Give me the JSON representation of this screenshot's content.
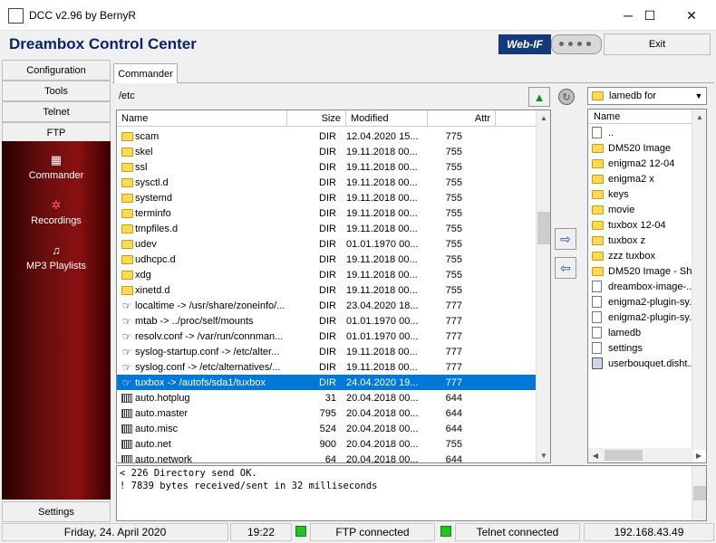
{
  "window": {
    "title": "DCC v2.96 by BernyR",
    "minimize": "─",
    "maximize": "☐",
    "close": "✕"
  },
  "header": {
    "app_title": "Dreambox Control Center",
    "webif_label": "Web-IF",
    "exit_label": "Exit"
  },
  "sidebar": {
    "buttons": [
      "Configuration",
      "Tools",
      "Telnet",
      "FTP"
    ],
    "panel_items": [
      {
        "label": "Commander",
        "icon": "grid-icon"
      },
      {
        "label": "Recordings",
        "icon": "film-icon"
      },
      {
        "label": "MP3 Playlists",
        "icon": "note-icon"
      }
    ],
    "settings_label": "Settings"
  },
  "commander": {
    "tab_label": "Commander",
    "path": "/etc",
    "columns": {
      "name": "Name",
      "size": "Size",
      "modified": "Modified",
      "attr": "Attr"
    },
    "rows": [
      {
        "icon": "folder",
        "name": "scam",
        "size": "DIR",
        "modified": "12.04.2020 15...",
        "attr": "775"
      },
      {
        "icon": "folder",
        "name": "skel",
        "size": "DIR",
        "modified": "19.11.2018 00...",
        "attr": "755"
      },
      {
        "icon": "folder",
        "name": "ssl",
        "size": "DIR",
        "modified": "19.11.2018 00...",
        "attr": "755"
      },
      {
        "icon": "folder",
        "name": "sysctl.d",
        "size": "DIR",
        "modified": "19.11.2018 00...",
        "attr": "755"
      },
      {
        "icon": "folder",
        "name": "systemd",
        "size": "DIR",
        "modified": "19.11.2018 00...",
        "attr": "755"
      },
      {
        "icon": "folder",
        "name": "terminfo",
        "size": "DIR",
        "modified": "19.11.2018 00...",
        "attr": "755"
      },
      {
        "icon": "folder",
        "name": "tmpfiles.d",
        "size": "DIR",
        "modified": "19.11.2018 00...",
        "attr": "755"
      },
      {
        "icon": "folder",
        "name": "udev",
        "size": "DIR",
        "modified": "01.01.1970 00...",
        "attr": "755"
      },
      {
        "icon": "folder",
        "name": "udhcpc.d",
        "size": "DIR",
        "modified": "19.11.2018 00...",
        "attr": "755"
      },
      {
        "icon": "folder",
        "name": "xdg",
        "size": "DIR",
        "modified": "19.11.2018 00...",
        "attr": "755"
      },
      {
        "icon": "folder",
        "name": "xinetd.d",
        "size": "DIR",
        "modified": "19.11.2018 00...",
        "attr": "755"
      },
      {
        "icon": "link",
        "name": "localtime -> /usr/share/zoneinfo/...",
        "size": "DIR",
        "modified": "23.04.2020 18...",
        "attr": "777"
      },
      {
        "icon": "link",
        "name": "mtab -> ../proc/self/mounts",
        "size": "DIR",
        "modified": "01.01.1970 00...",
        "attr": "777"
      },
      {
        "icon": "link",
        "name": "resolv.conf -> /var/run/connman...",
        "size": "DIR",
        "modified": "01.01.1970 00...",
        "attr": "777"
      },
      {
        "icon": "link",
        "name": "syslog-startup.conf -> /etc/alter...",
        "size": "DIR",
        "modified": "19.11.2018 00...",
        "attr": "777"
      },
      {
        "icon": "link",
        "name": "syslog.conf -> /etc/alternatives/...",
        "size": "DIR",
        "modified": "19.11.2018 00...",
        "attr": "777"
      },
      {
        "icon": "link",
        "name": "tuxbox -> /autofs/sda1/tuxbox",
        "size": "DIR",
        "modified": "24.04.2020 19...",
        "attr": "777",
        "selected": true
      },
      {
        "icon": "file",
        "name": "auto.hotplug",
        "size": "31",
        "modified": "20.04.2018 00...",
        "attr": "644"
      },
      {
        "icon": "file",
        "name": "auto.master",
        "size": "795",
        "modified": "20.04.2018 00...",
        "attr": "644"
      },
      {
        "icon": "file",
        "name": "auto.misc",
        "size": "524",
        "modified": "20.04.2018 00...",
        "attr": "644"
      },
      {
        "icon": "file",
        "name": "auto.net",
        "size": "900",
        "modified": "20.04.2018 00...",
        "attr": "755"
      },
      {
        "icon": "file",
        "name": "auto.network",
        "size": "64",
        "modified": "20.04.2018 00...",
        "attr": "644"
      }
    ],
    "scroll_fraction": 0.3
  },
  "local": {
    "selected_dir": "lamedb for",
    "column": "Name",
    "rows": [
      {
        "icon": "doc",
        "name": ".."
      },
      {
        "icon": "folder",
        "name": "DM520 Image"
      },
      {
        "icon": "folder",
        "name": "enigma2 12-04"
      },
      {
        "icon": "folder",
        "name": "enigma2 x"
      },
      {
        "icon": "folder",
        "name": "keys"
      },
      {
        "icon": "folder",
        "name": "movie"
      },
      {
        "icon": "folder",
        "name": "tuxbox 12-04"
      },
      {
        "icon": "folder",
        "name": "tuxbox z"
      },
      {
        "icon": "folder",
        "name": "zzz tuxbox"
      },
      {
        "icon": "folder",
        "name": "DM520 Image - Sh..."
      },
      {
        "icon": "doc",
        "name": "dreambox-image-..."
      },
      {
        "icon": "doc",
        "name": "enigma2-plugin-sy..."
      },
      {
        "icon": "doc",
        "name": "enigma2-plugin-sy..."
      },
      {
        "icon": "doc",
        "name": "lamedb"
      },
      {
        "icon": "doc",
        "name": "settings"
      },
      {
        "icon": "db",
        "name": "userbouquet.disht..."
      }
    ]
  },
  "log": {
    "lines": [
      "< 226 Directory send OK.",
      "! 7839 bytes received/sent in 32 milliseconds"
    ]
  },
  "status": {
    "date": "Friday, 24. April 2020",
    "time": "19:22",
    "ftp": "FTP connected",
    "telnet": "Telnet connected",
    "ip": "192.168.43.49"
  },
  "colors": {
    "selection": "#0078d7",
    "title": "#0a246a",
    "sidebar_dark": "#6a0e0e",
    "led": "#22c422"
  }
}
